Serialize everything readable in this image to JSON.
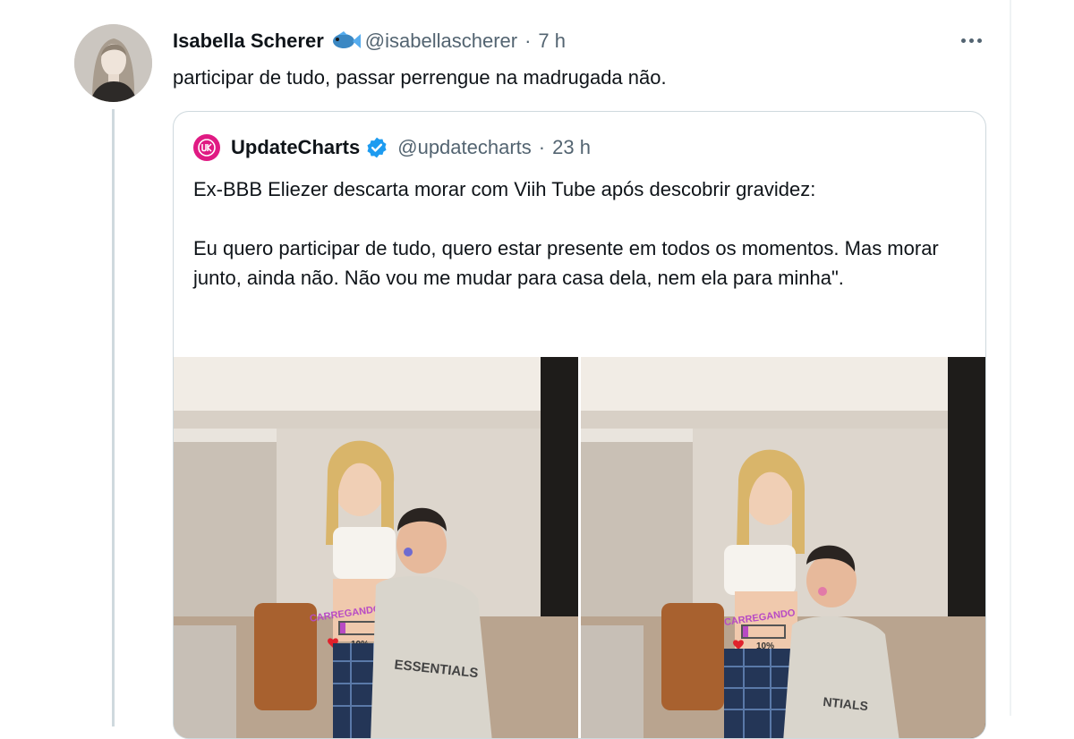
{
  "tweet": {
    "author_name": "Isabella Scherer",
    "author_emoji": "fish-icon",
    "handle": "@isabellascherer",
    "separator": "·",
    "time": "7 h",
    "text": "participar de tudo, passar perrengue na madrugada não."
  },
  "quote": {
    "author_name": "UpdateCharts",
    "verified": true,
    "handle": "@updatecharts",
    "separator": "·",
    "time": "23 h",
    "paragraph_1": "Ex-BBB Eliezer descarta morar com Viih Tube após descobrir gravidez:",
    "paragraph_2": "Eu quero participar de tudo, quero estar presente em todos os momentos. Mas morar junto, ainda não. Não vou me mudar para casa dela, nem ela para minha\".",
    "photos": [
      {
        "belly_text": "CARREGANDO",
        "percent": "10%",
        "shirt_text": "ESSENTIALS"
      },
      {
        "belly_text": "CARREGANDO",
        "percent": "10%",
        "shirt_text": "NTIALS"
      }
    ]
  },
  "colors": {
    "text": "#0f1419",
    "secondary": "#536471",
    "border": "#cfd9de",
    "verified": "#1d9bf0",
    "brand_pink": "#e01a83"
  }
}
